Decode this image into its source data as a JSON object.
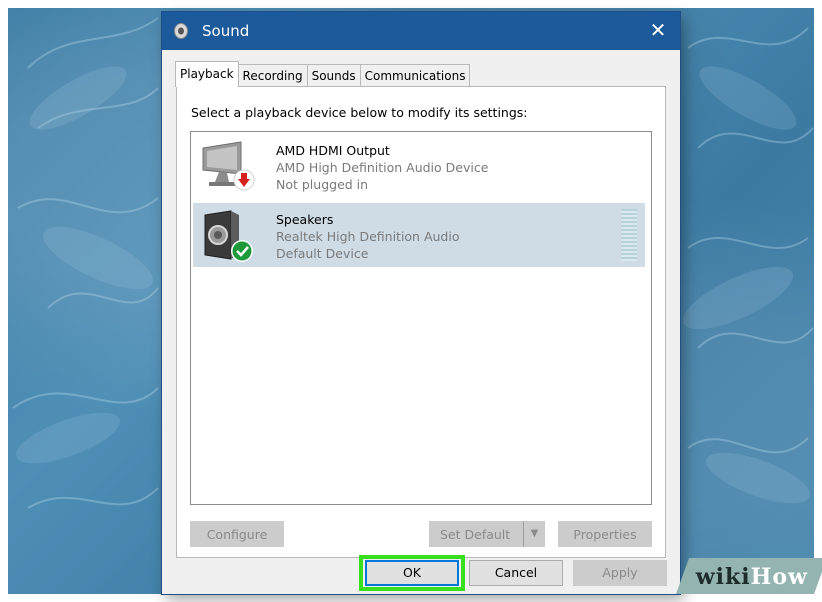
{
  "window": {
    "title": "Sound",
    "close_label": "✕"
  },
  "tabs": [
    {
      "label": "Playback",
      "active": true
    },
    {
      "label": "Recording",
      "active": false
    },
    {
      "label": "Sounds",
      "active": false
    },
    {
      "label": "Communications",
      "active": false
    }
  ],
  "playback": {
    "instruction": "Select a playback device below to modify its settings:",
    "devices": [
      {
        "name": "AMD HDMI Output",
        "description": "AMD High Definition Audio Device",
        "status": "Not plugged in",
        "icon": "monitor-speaker-icon",
        "badge": "unplugged-arrow-icon",
        "selected": false
      },
      {
        "name": "Speakers",
        "description": "Realtek High Definition Audio",
        "status": "Default Device",
        "icon": "speaker-icon",
        "badge": "default-check-icon",
        "selected": true
      }
    ],
    "buttons": {
      "configure": "Configure",
      "set_default": "Set Default",
      "set_default_arrow": "▼",
      "properties": "Properties"
    }
  },
  "footer": {
    "ok": "OK",
    "cancel": "Cancel",
    "apply": "Apply"
  },
  "watermark": {
    "wiki": "wiki",
    "how": "How"
  },
  "colors": {
    "titlebar": "#1c5a9b",
    "selection": "#cfdce6",
    "highlight": "#36e01e",
    "focus": "#0078d7"
  }
}
